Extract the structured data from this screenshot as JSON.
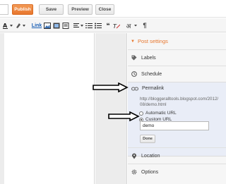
{
  "toolbar_top": {
    "publish_label": "Publish",
    "save_label": "Save",
    "preview_label": "Preview",
    "close_label": "Close"
  },
  "format_toolbar": {
    "link_label": "Link",
    "hindi_label": "अ",
    "quote_label": "❝",
    "ltr_label": "¶"
  },
  "sidebar": {
    "header": "Post settings",
    "labels": "Labels",
    "schedule": "Schedule",
    "permalink": {
      "title": "Permalink",
      "url_line1": "http://bloggeralltools.blogspot.com/2012/",
      "url_line2": "08/demo.html",
      "automatic_label": "Automatic URL",
      "custom_label": "Custom URL",
      "selected": "Custom URL",
      "custom_value": "demo",
      "done_label": "Done"
    },
    "location": "Location",
    "options": "Options"
  },
  "colors": {
    "accent": "#e8772e",
    "permalink_bg": "#e9edf7"
  }
}
